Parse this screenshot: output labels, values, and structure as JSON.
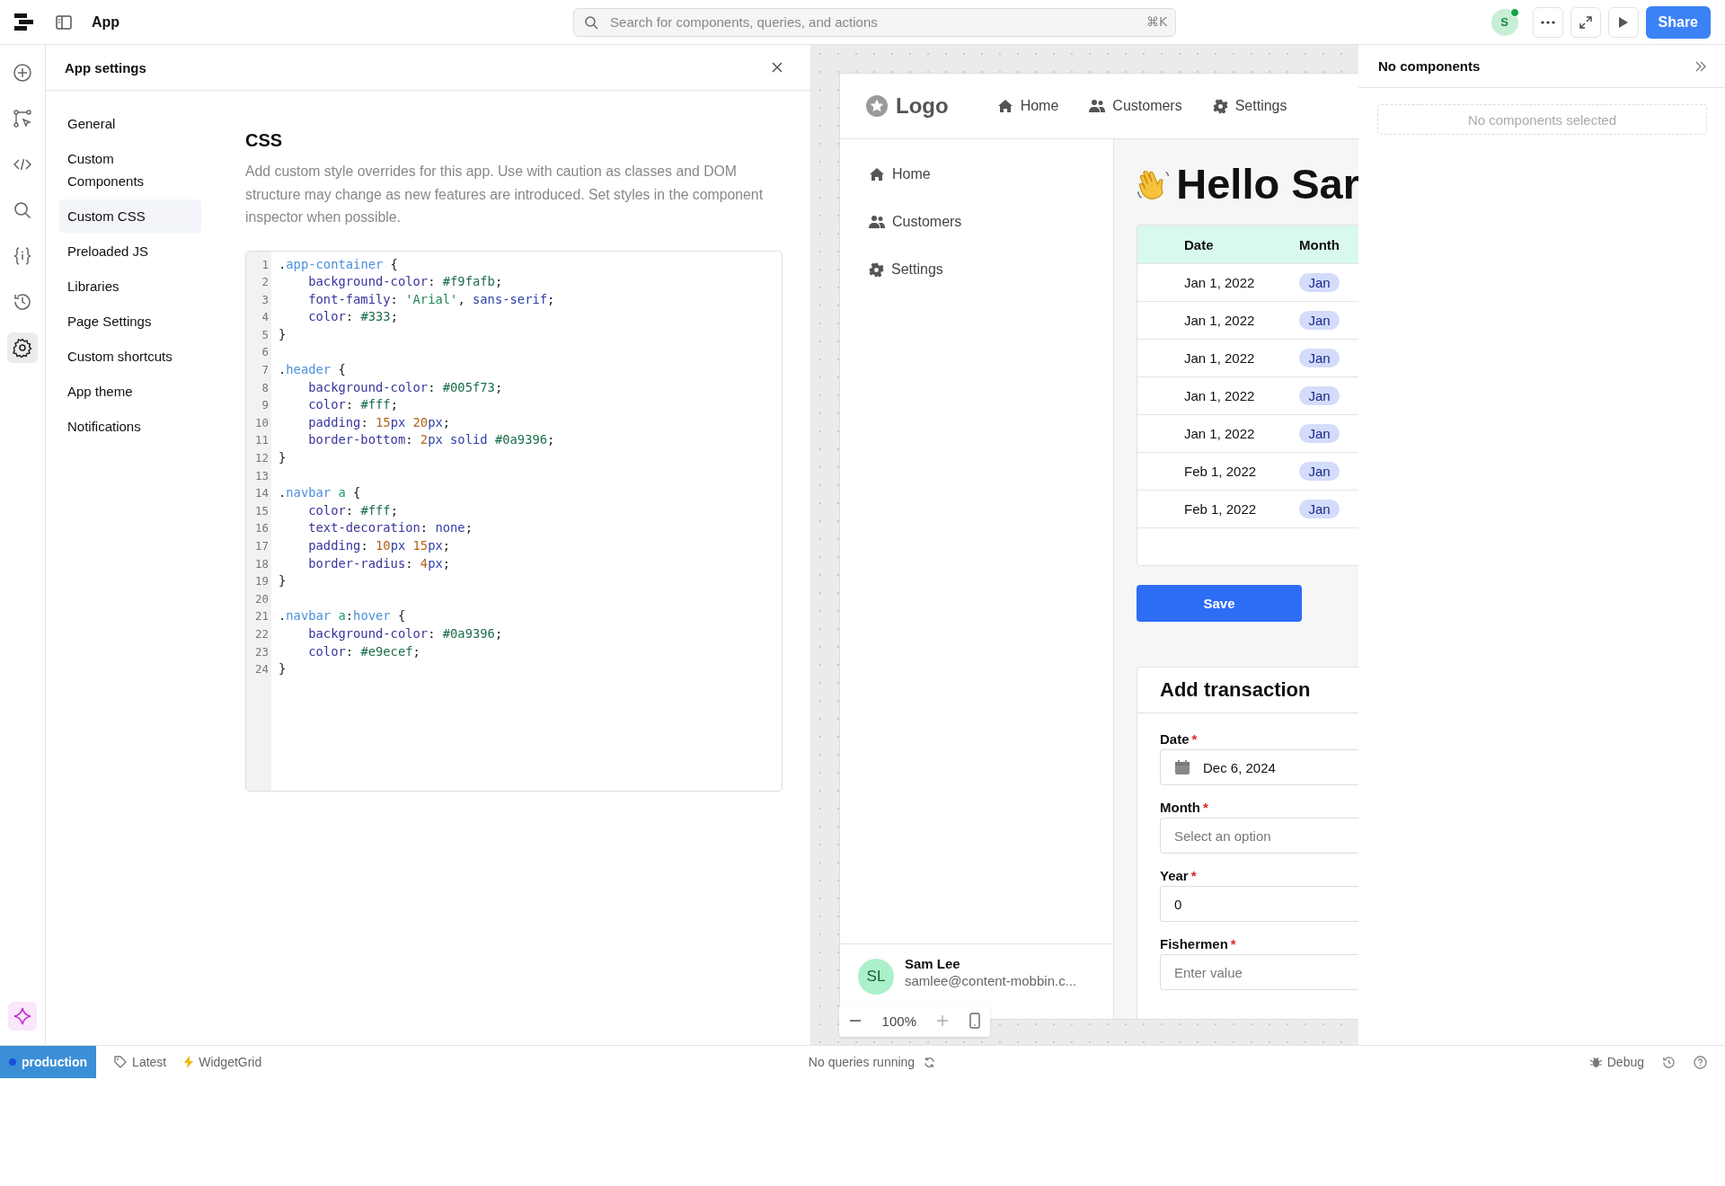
{
  "topbar": {
    "title": "App",
    "search": {
      "placeholder": "Search for components, queries, and actions",
      "shortcut": "⌘K"
    },
    "avatar": "S",
    "share": "Share"
  },
  "settings": {
    "title": "App settings",
    "nav": [
      {
        "label": "General",
        "selected": false
      },
      {
        "label": "Custom Components",
        "selected": false
      },
      {
        "label": "Custom CSS",
        "selected": true
      },
      {
        "label": "Preloaded JS",
        "selected": false
      },
      {
        "label": "Libraries",
        "selected": false
      },
      {
        "label": "Page Settings",
        "selected": false
      },
      {
        "label": "Custom shortcuts",
        "selected": false
      },
      {
        "label": "App theme",
        "selected": false
      },
      {
        "label": "Notifications",
        "selected": false
      }
    ],
    "heading": "CSS",
    "description": "Add custom style overrides for this app. Use with caution as classes and DOM structure may change as new features are introduced. Set styles in the component inspector when possible.",
    "code": [
      {
        "n": "1",
        "indent": false,
        "tokens": [
          {
            "kind": "p",
            "text": "."
          },
          {
            "kind": "sel",
            "text": "app-container"
          },
          {
            "kind": "p",
            "text": " {"
          }
        ]
      },
      {
        "n": "2",
        "indent": true,
        "tokens": [
          {
            "kind": "prop",
            "text": "background-color"
          },
          {
            "kind": "p",
            "text": ": "
          },
          {
            "kind": "hex",
            "text": "#f9fafb"
          },
          {
            "kind": "p",
            "text": ";"
          }
        ]
      },
      {
        "n": "3",
        "indent": true,
        "tokens": [
          {
            "kind": "prop",
            "text": "font-family"
          },
          {
            "kind": "p",
            "text": ": "
          },
          {
            "kind": "str",
            "text": "'Arial'"
          },
          {
            "kind": "p",
            "text": ", "
          },
          {
            "kind": "kw",
            "text": "sans-serif"
          },
          {
            "kind": "p",
            "text": ";"
          }
        ]
      },
      {
        "n": "4",
        "indent": true,
        "tokens": [
          {
            "kind": "prop",
            "text": "color"
          },
          {
            "kind": "p",
            "text": ": "
          },
          {
            "kind": "hex",
            "text": "#333"
          },
          {
            "kind": "p",
            "text": ";"
          }
        ]
      },
      {
        "n": "5",
        "indent": false,
        "tokens": [
          {
            "kind": "p",
            "text": "}"
          }
        ]
      },
      {
        "n": "6"
      },
      {
        "n": "7",
        "indent": false,
        "tokens": [
          {
            "kind": "p",
            "text": "."
          },
          {
            "kind": "sel",
            "text": "header"
          },
          {
            "kind": "p",
            "text": " {"
          }
        ]
      },
      {
        "n": "8",
        "indent": true,
        "tokens": [
          {
            "kind": "prop",
            "text": "background-color"
          },
          {
            "kind": "p",
            "text": ": "
          },
          {
            "kind": "hex",
            "text": "#005f73"
          },
          {
            "kind": "p",
            "text": ";"
          }
        ]
      },
      {
        "n": "9",
        "indent": true,
        "tokens": [
          {
            "kind": "prop",
            "text": "color"
          },
          {
            "kind": "p",
            "text": ": "
          },
          {
            "kind": "hex",
            "text": "#fff"
          },
          {
            "kind": "p",
            "text": ";"
          }
        ]
      },
      {
        "n": "10",
        "indent": true,
        "tokens": [
          {
            "kind": "prop",
            "text": "padding"
          },
          {
            "kind": "p",
            "text": ": "
          },
          {
            "kind": "num",
            "text": "15"
          },
          {
            "kind": "kw",
            "text": "px"
          },
          {
            "kind": "num",
            "text": " 20"
          },
          {
            "kind": "kw",
            "text": "px"
          },
          {
            "kind": "p",
            "text": ";"
          }
        ]
      },
      {
        "n": "11",
        "indent": true,
        "tokens": [
          {
            "kind": "prop",
            "text": "border-bottom"
          },
          {
            "kind": "p",
            "text": ": "
          },
          {
            "kind": "num",
            "text": "2"
          },
          {
            "kind": "kw",
            "text": "px solid"
          },
          {
            "kind": "hex",
            "text": " #0a9396"
          },
          {
            "kind": "p",
            "text": ";"
          }
        ]
      },
      {
        "n": "12",
        "indent": false,
        "tokens": [
          {
            "kind": "p",
            "text": "}"
          }
        ]
      },
      {
        "n": "13"
      },
      {
        "n": "14",
        "indent": false,
        "tokens": [
          {
            "kind": "p",
            "text": "."
          },
          {
            "kind": "sel",
            "text": "navbar"
          },
          {
            "kind": "tag",
            "text": " a"
          },
          {
            "kind": "p",
            "text": " {"
          }
        ]
      },
      {
        "n": "15",
        "indent": true,
        "tokens": [
          {
            "kind": "prop",
            "text": "color"
          },
          {
            "kind": "p",
            "text": ": "
          },
          {
            "kind": "hex",
            "text": "#fff"
          },
          {
            "kind": "p",
            "text": ";"
          }
        ]
      },
      {
        "n": "16",
        "indent": true,
        "tokens": [
          {
            "kind": "prop",
            "text": "text-decoration"
          },
          {
            "kind": "p",
            "text": ": "
          },
          {
            "kind": "kw",
            "text": "none"
          },
          {
            "kind": "p",
            "text": ";"
          }
        ]
      },
      {
        "n": "17",
        "indent": true,
        "tokens": [
          {
            "kind": "prop",
            "text": "padding"
          },
          {
            "kind": "p",
            "text": ": "
          },
          {
            "kind": "num",
            "text": "10"
          },
          {
            "kind": "kw",
            "text": "px"
          },
          {
            "kind": "num",
            "text": " 15"
          },
          {
            "kind": "kw",
            "text": "px"
          },
          {
            "kind": "p",
            "text": ";"
          }
        ]
      },
      {
        "n": "18",
        "indent": true,
        "tokens": [
          {
            "kind": "prop",
            "text": "border-radius"
          },
          {
            "kind": "p",
            "text": ": "
          },
          {
            "kind": "num",
            "text": "4"
          },
          {
            "kind": "kw",
            "text": "px"
          },
          {
            "kind": "p",
            "text": ";"
          }
        ]
      },
      {
        "n": "19",
        "indent": false,
        "tokens": [
          {
            "kind": "p",
            "text": "}"
          }
        ]
      },
      {
        "n": "20"
      },
      {
        "n": "21",
        "indent": false,
        "tokens": [
          {
            "kind": "p",
            "text": "."
          },
          {
            "kind": "sel",
            "text": "navbar"
          },
          {
            "kind": "tag",
            "text": " a"
          },
          {
            "kind": "p",
            "text": ":"
          },
          {
            "kind": "sel",
            "text": "hover"
          },
          {
            "kind": "p",
            "text": " {"
          }
        ]
      },
      {
        "n": "22",
        "indent": true,
        "tokens": [
          {
            "kind": "prop",
            "text": "background-color"
          },
          {
            "kind": "p",
            "text": ": "
          },
          {
            "kind": "hex",
            "text": "#0a9396"
          },
          {
            "kind": "p",
            "text": ";"
          }
        ]
      },
      {
        "n": "23",
        "indent": true,
        "tokens": [
          {
            "kind": "prop",
            "text": "color"
          },
          {
            "kind": "p",
            "text": ": "
          },
          {
            "kind": "hex",
            "text": "#e9ecef"
          },
          {
            "kind": "p",
            "text": ";"
          }
        ]
      },
      {
        "n": "24",
        "indent": false,
        "tokens": [
          {
            "kind": "p",
            "text": "}"
          }
        ]
      }
    ]
  },
  "preview": {
    "logo": "Logo",
    "topnav": [
      "Home",
      "Customers",
      "Settings"
    ],
    "sidenav": [
      "Home",
      "Customers",
      "Settings"
    ],
    "user": {
      "initials": "SL",
      "name": "Sam Lee",
      "email": "samlee@content-mobbin.c..."
    },
    "greeting": "Hello Sar",
    "table": {
      "columns": [
        "Date",
        "Month"
      ],
      "rows": [
        [
          "Jan 1, 2022",
          "Jan"
        ],
        [
          "Jan 1, 2022",
          "Jan"
        ],
        [
          "Jan 1, 2022",
          "Jan"
        ],
        [
          "Jan 1, 2022",
          "Jan"
        ],
        [
          "Jan 1, 2022",
          "Jan"
        ],
        [
          "Feb 1, 2022",
          "Jan"
        ],
        [
          "Feb 1, 2022",
          "Jan"
        ]
      ]
    },
    "save": "Save",
    "form": {
      "title": "Add transaction",
      "fields": [
        {
          "label": "Date",
          "required": "*",
          "kind": "date",
          "value": "Dec 6, 2024"
        },
        {
          "label": "Month",
          "required": "*",
          "kind": "select",
          "placeholder": "Select an option"
        },
        {
          "label": "Year",
          "required": "*",
          "kind": "text",
          "value": "0"
        },
        {
          "label": "Fishermen",
          "required": "*",
          "kind": "text",
          "placeholder": "Enter value"
        }
      ]
    },
    "zoom": "100%"
  },
  "inspector": {
    "title": "No components",
    "empty": "No components selected"
  },
  "status": {
    "env": "production",
    "version": "Latest",
    "grid": "WidgetGrid",
    "queries": "No queries running",
    "debug": "Debug"
  }
}
